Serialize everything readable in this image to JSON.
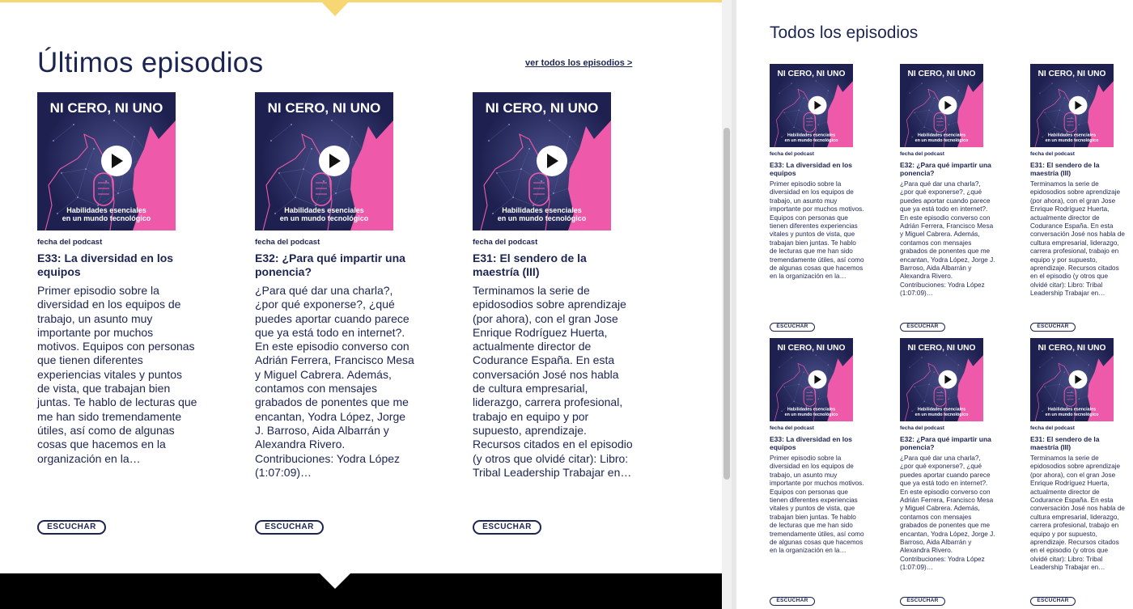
{
  "latest": {
    "heading": "Últimos episodios",
    "see_all": "ver todos los episodios >",
    "episodes": [
      {
        "date": "fecha del podcast",
        "title": "E33: La diversidad en los equipos",
        "description": "Primer episodio sobre la diversidad en los equipos de trabajo, un asunto muy importante por muchos motivos. Equipos con personas que tienen diferentes experiencias vitales y puntos de vista, que trabajan bien juntas. Te hablo de lecturas que me han sido tremendamente útiles, así como de algunas cosas que hacemos en la organización en la…",
        "button": "ESCUCHAR"
      },
      {
        "date": "fecha del podcast",
        "title": "E32: ¿Para qué impartir una ponencia?",
        "description": "¿Para qué dar una charla?, ¿por qué exponerse?, ¿qué puedes aportar cuando parece que ya está todo en internet?. En este episodio converso con Adrián Ferrera, Francisco Mesa y Miguel Cabrera. Además, contamos con mensajes grabados de ponentes que me encantan, Yodra López, Jorge J. Barroso, Aida Albarrán y Alexandra Rivero. Contribuciones: Yodra López (1:07:09)…",
        "button": "ESCUCHAR"
      },
      {
        "date": "fecha del podcast",
        "title": "E31: El sendero de la maestría (III)",
        "description": "Terminamos la serie de epidosodios sobre aprendizaje (por ahora), con el gran Jose Enrique Rodríguez Huerta, actualmente director de Codurance España. En esta conversación José nos habla de cultura empresarial, liderazgo, carrera profesional, trabajo en equipo y por supuesto, aprendizaje. Recursos citados en el episodio (y otros que olvidé citar): Libro: Tribal Leadership Trabajar en…",
        "button": "ESCUCHAR"
      }
    ]
  },
  "all": {
    "heading": "Todos los episodios",
    "episodes": [
      {
        "date": "fecha del podcast",
        "title": "E33: La diversidad en los equipos",
        "description": "Primer episodio sobre la diversidad en los equipos de trabajo, un asunto muy importante por muchos motivos. Equipos con personas que tienen diferentes experiencias vitales y puntos de vista, que trabajan bien juntas. Te hablo de lecturas que me han sido tremendamente útiles, así como de algunas cosas que hacemos en la organización en la…",
        "button": "ESCUCHAR"
      },
      {
        "date": "fecha del podcast",
        "title": "E32: ¿Para qué impartir una ponencia?",
        "description": "¿Para qué dar una charla?, ¿por qué exponerse?, ¿qué puedes aportar cuando parece que ya está todo en internet?. En este episodio converso con Adrián Ferrera, Francisco Mesa y Miguel Cabrera. Además, contamos con mensajes grabados de ponentes que me encantan, Yodra López, Jorge J. Barroso, Aida Albarrán y Alexandra Rivero. Contribuciones: Yodra López (1:07:09)…",
        "button": "ESCUCHAR"
      },
      {
        "date": "fecha del podcast",
        "title": "E31: El sendero de la maestría (III)",
        "description": "Terminamos la serie de epidosodios sobre aprendizaje (por ahora), con el gran Jose Enrique Rodríguez Huerta, actualmente director de Codurance España. En esta conversación José nos habla de cultura empresarial, liderazgo, carrera profesional, trabajo en equipo y por supuesto, aprendizaje. Recursos citados en el episodio (y otros que olvidé citar): Libro: Tribal Leadership Trabajar en…",
        "button": "ESCUCHAR"
      },
      {
        "date": "fecha del podcast",
        "title": "E33: La diversidad en los equipos",
        "description": "Primer episodio sobre la diversidad en los equipos de trabajo, un asunto muy importante por muchos motivos. Equipos con personas que tienen diferentes experiencias vitales y puntos de vista, que trabajan bien juntas. Te hablo de lecturas que me han sido tremendamente útiles, así como de algunas cosas que hacemos en la organización en la…",
        "button": "ESCUCHAR"
      },
      {
        "date": "fecha del podcast",
        "title": "E32: ¿Para qué impartir una ponencia?",
        "description": "¿Para qué dar una charla?, ¿por qué exponerse?, ¿qué puedes aportar cuando parece que ya está todo en internet?. En este episodio converso con Adrián Ferrera, Francisco Mesa y Miguel Cabrera. Además, contamos con mensajes grabados de ponentes que me encantan, Yodra López, Jorge J. Barroso, Aida Albarrán y Alexandra Rivero. Contribuciones: Yodra López (1:07:09)…",
        "button": "ESCUCHAR"
      },
      {
        "date": "fecha del podcast",
        "title": "E31: El sendero de la maestría (III)",
        "description": "Terminamos la serie de epidosodios sobre aprendizaje (por ahora), con el gran Jose Enrique Rodríguez Huerta, actualmente director de Codurance España. En esta conversación José nos habla de cultura empresarial, liderazgo, carrera profesional, trabajo en equipo y por supuesto, aprendizaje. Recursos citados en el episodio (y otros que olvidé citar): Libro: Tribal Leadership Trabajar en…",
        "button": "ESCUCHAR"
      }
    ]
  },
  "cover": {
    "title": "NI CERO, NI UNO",
    "subtitle_line1": "Habilidades esenciales",
    "subtitle_line2": "en un mundo tecnológico",
    "bg_color": "#1e2150",
    "accent_color": "#ee5aa9",
    "icon": "play-icon"
  },
  "colors": {
    "text": "#1c2452",
    "top_bar": "#f7d774",
    "footer": "#000000"
  }
}
